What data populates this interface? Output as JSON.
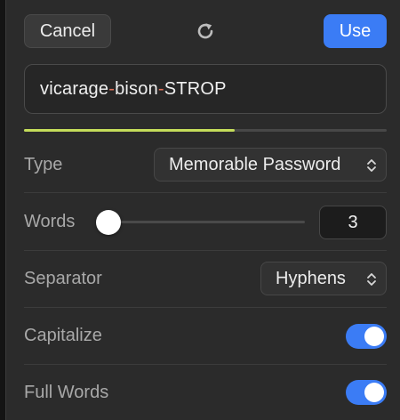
{
  "header": {
    "cancel_label": "Cancel",
    "use_label": "Use",
    "refresh_icon": "refresh-icon"
  },
  "password": {
    "part1": "vicarage",
    "sep1": "-",
    "part2": "bison",
    "sep2": "-",
    "part3": "STROP",
    "strength_fraction": 0.58,
    "strength_color": "#c4dc5a",
    "separator_color": "#e2725b"
  },
  "settings": {
    "type": {
      "label": "Type",
      "value": "Memorable Password"
    },
    "words": {
      "label": "Words",
      "value": "3",
      "slider_level": 0.0
    },
    "separator": {
      "label": "Separator",
      "value": "Hyphens"
    },
    "capitalize": {
      "label": "Capitalize",
      "on": true
    },
    "full_words": {
      "label": "Full Words",
      "on": true
    }
  },
  "colors": {
    "accent": "#3b7cf5",
    "panel_bg": "#2b2b2b"
  }
}
